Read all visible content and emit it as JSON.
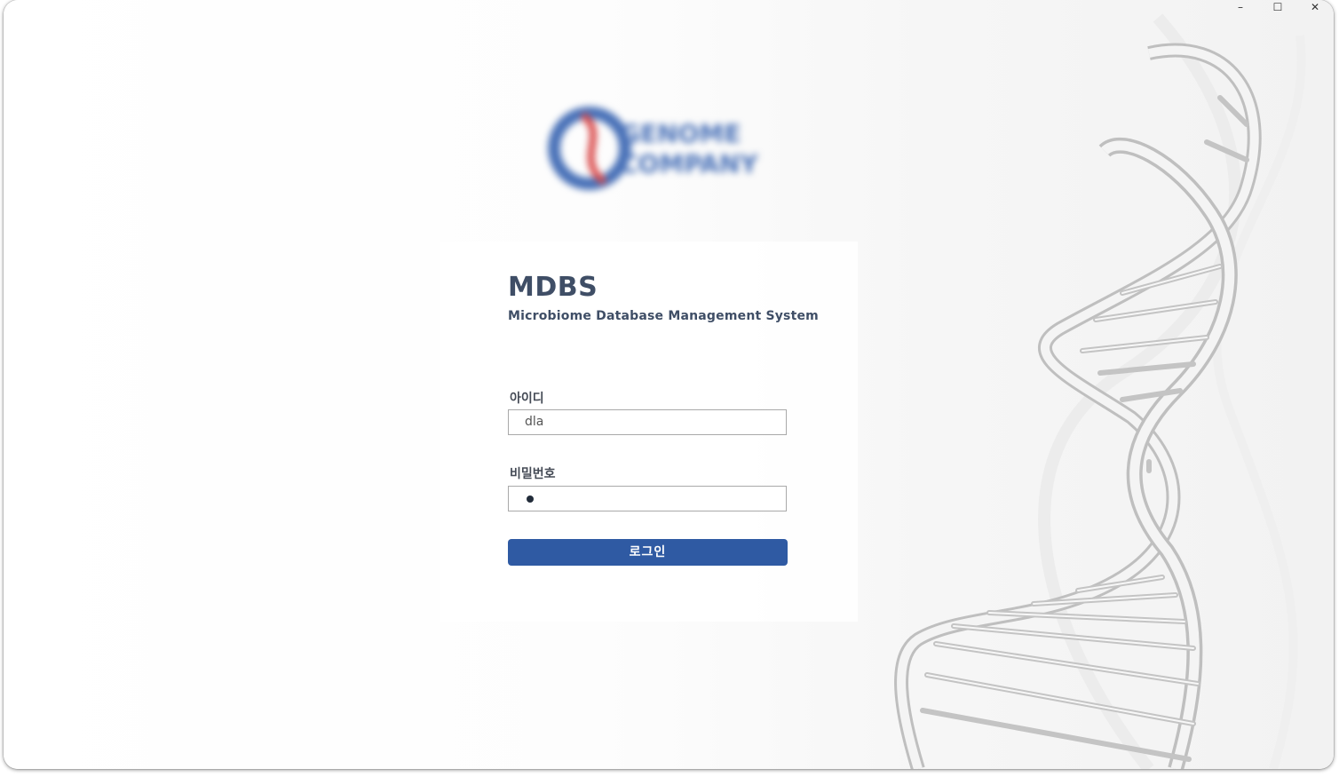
{
  "window": {
    "controls": {
      "minimize": "–",
      "maximize": "☐",
      "close": "✕"
    }
  },
  "logo": {
    "line1": "GENOME",
    "line2": "COMPANY",
    "icon": "genome-company-logo-icon",
    "colors": {
      "blue": "#4a72b8",
      "red": "#d94a4a"
    }
  },
  "app": {
    "title": "MDBS",
    "subtitle": "Microbiome Database Management System"
  },
  "form": {
    "id_label": "아이디",
    "id_value": "dla",
    "password_label": "비밀번호",
    "password_masked": "●",
    "login_label": "로그인"
  },
  "colors": {
    "accent": "#2f5aa3",
    "title": "#3f4e66"
  },
  "decoration": {
    "icon": "dna-helix-icon"
  }
}
